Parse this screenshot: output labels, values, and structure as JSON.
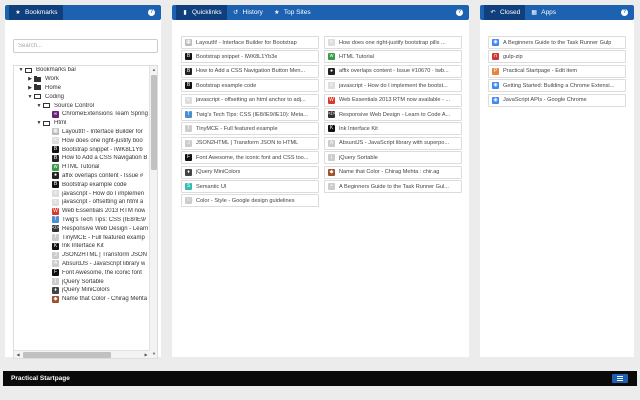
{
  "bookmarks_panel": {
    "tab_label": "Bookmarks",
    "search_placeholder": "Search...",
    "tree": [
      {
        "label": "Bookmarks bar",
        "level": 0,
        "type": "folder-open",
        "twisty": "▼"
      },
      {
        "label": "Work",
        "level": 1,
        "type": "folder",
        "twisty": "▶"
      },
      {
        "label": "Home",
        "level": 1,
        "type": "folder",
        "twisty": "▶"
      },
      {
        "label": "Coding",
        "level": 1,
        "type": "folder-open",
        "twisty": "▼"
      },
      {
        "label": "Source Control",
        "level": 2,
        "type": "folder-open",
        "twisty": "▼"
      },
      {
        "label": "ChromeExtensions Team Spring",
        "level": 3,
        "type": "link",
        "icon": "tfs",
        "color": "#68217a"
      },
      {
        "label": "Html",
        "level": 2,
        "type": "folder-open",
        "twisty": "▼"
      },
      {
        "label": "LayoutIt! - Interface Builder for",
        "level": 3,
        "type": "link",
        "icon": "grid",
        "color": "#bbb"
      },
      {
        "label": "How does one right-justify boo",
        "level": 3,
        "type": "link",
        "icon": "so",
        "color": "#ddd"
      },
      {
        "label": "Bootstrap snippet - IWK8L1Yb",
        "level": 3,
        "type": "link",
        "icon": "bs",
        "color": "#111"
      },
      {
        "label": "How to Add a CSS Navigation B",
        "level": 3,
        "type": "link",
        "icon": "bs",
        "color": "#222"
      },
      {
        "label": "HTML Tutorial",
        "level": 3,
        "type": "link",
        "icon": "w3",
        "color": "#3a9c49"
      },
      {
        "label": "affix overlaps content - Issue #",
        "level": 3,
        "type": "link",
        "icon": "gh",
        "color": "#222"
      },
      {
        "label": "Bootstrap example code",
        "level": 3,
        "type": "link",
        "icon": "bs",
        "color": "#111"
      },
      {
        "label": "javascript - How do I implemen",
        "level": 3,
        "type": "link",
        "icon": "so",
        "color": "#ddd"
      },
      {
        "label": "javascript - offsetting an html a",
        "level": 3,
        "type": "link",
        "icon": "so",
        "color": "#ddd"
      },
      {
        "label": "Web Essentials 2013 RTM now",
        "level": 3,
        "type": "link",
        "icon": "we",
        "color": "#d9392b"
      },
      {
        "label": "Twig's Tech Tips: CSS (IE8/IE9/",
        "level": 3,
        "type": "link",
        "icon": "tt",
        "color": "#4a8fd6"
      },
      {
        "label": "Responsive Web Design - Learn",
        "level": 3,
        "type": "link",
        "icon": "rw",
        "color": "#333"
      },
      {
        "label": "TinyMCE - Full featured examp",
        "level": 3,
        "type": "link",
        "icon": "tm",
        "color": "#ccc"
      },
      {
        "label": "Ink Interface Kit",
        "level": 3,
        "type": "link",
        "icon": "ik",
        "color": "#111"
      },
      {
        "label": "JSON2HTML | Transform JSON",
        "level": 3,
        "type": "link",
        "icon": "jh",
        "color": "#ccc"
      },
      {
        "label": "AbsurdJS - JavaScript library w",
        "level": 3,
        "type": "link",
        "icon": "ab",
        "color": "#ccc"
      },
      {
        "label": "Font Awesome, the iconic font",
        "level": 3,
        "type": "link",
        "icon": "fa",
        "color": "#111"
      },
      {
        "label": "jQuery Sortable",
        "level": 3,
        "type": "link",
        "icon": "jq",
        "color": "#ccc"
      },
      {
        "label": "jQuery MiniColors",
        "level": 3,
        "type": "link",
        "icon": "jm",
        "color": "#444"
      },
      {
        "label": "Name that Color - Chirag Mehta",
        "level": 3,
        "type": "link",
        "icon": "nc",
        "color": "#a0522d"
      }
    ]
  },
  "quicklinks_panel": {
    "tabs": [
      {
        "label": "Quicklinks",
        "icon": "bookmark-icon",
        "active": true
      },
      {
        "label": "History",
        "icon": "history-icon",
        "active": false
      },
      {
        "label": "Top Sites",
        "icon": "star-icon",
        "active": false
      }
    ],
    "links": [
      {
        "label": "LayoutIt! - Interface Builder for Bootstrap",
        "icon": "grid",
        "color": "#bbb"
      },
      {
        "label": "How does one right-justify bootstrap pills ...",
        "icon": "so",
        "color": "#ddd"
      },
      {
        "label": "Bootstrap snippet - IWK8L1Yb3e",
        "icon": "bs",
        "color": "#111"
      },
      {
        "label": "HTML Tutorial",
        "icon": "w3",
        "color": "#3a9c49"
      },
      {
        "label": "How to Add a CSS Navigation Button Men...",
        "icon": "bs",
        "color": "#222"
      },
      {
        "label": "affix overlaps content - Issue #10670 · twb...",
        "icon": "gh",
        "color": "#222"
      },
      {
        "label": "Bootstrap example code",
        "icon": "bs",
        "color": "#111"
      },
      {
        "label": "javascript - How do I implement the bootst...",
        "icon": "so",
        "color": "#ddd"
      },
      {
        "label": "javascript - offsetting an html anchor to adj...",
        "icon": "so",
        "color": "#ddd"
      },
      {
        "label": "Web Essentials 2013 RTM now available - ...",
        "icon": "we",
        "color": "#d9392b"
      },
      {
        "label": "Twig's Tech Tips: CSS (IE8/IE9/IE10): Meta...",
        "icon": "tt",
        "color": "#4a8fd6"
      },
      {
        "label": "Responsive Web Design - Learn to Code A...",
        "icon": "rw",
        "color": "#333"
      },
      {
        "label": "TinyMCE - Full featured example",
        "icon": "tm",
        "color": "#ccc"
      },
      {
        "label": "Ink Interface Kit",
        "icon": "ik",
        "color": "#111"
      },
      {
        "label": "JSON2HTML | Transform JSON to HTML",
        "icon": "jh",
        "color": "#ccc"
      },
      {
        "label": "AbsurdJS - JavaScript library with superpo...",
        "icon": "ab",
        "color": "#ccc"
      },
      {
        "label": "Font Awesome, the iconic font and CSS too...",
        "icon": "fa",
        "color": "#111"
      },
      {
        "label": "jQuery Sortable",
        "icon": "jq",
        "color": "#ccc"
      },
      {
        "label": "jQuery MiniColors",
        "icon": "jm",
        "color": "#444"
      },
      {
        "label": "Name that Color - Chirag Mehta : chir.ag",
        "icon": "nc",
        "color": "#a0522d"
      },
      {
        "label": "Semantic UI",
        "icon": "su",
        "color": "#35bdb2"
      },
      {
        "label": "A Beginners Guide to the Task Runner Gul...",
        "icon": "gp",
        "color": "#ccc"
      },
      {
        "label": "Color - Style - Google design guidelines",
        "icon": "gd",
        "color": "#ccc"
      }
    ]
  },
  "recent_panel": {
    "tabs": [
      {
        "label": "Closed",
        "icon": "undo-icon",
        "active": true
      },
      {
        "label": "Apps",
        "icon": "apps-icon",
        "active": false
      }
    ],
    "links": [
      {
        "label": "A Beginners Guide to the Task Runner Gulp",
        "icon": "chrome",
        "color": "#4285f4"
      },
      {
        "label": "gulp-zip",
        "icon": "npm",
        "color": "#cb3837"
      },
      {
        "label": "Practical Startpage - Edit item",
        "icon": "ps",
        "color": "#e8833a"
      },
      {
        "label": "Getting Started: Building a Chrome Extensi...",
        "icon": "chrome",
        "color": "#4285f4"
      },
      {
        "label": "JavaScript APIs - Google Chrome",
        "icon": "chrome",
        "color": "#4285f4"
      }
    ]
  },
  "footer": {
    "title": "Practical Startpage"
  },
  "colors": {
    "accent": "#1d61b1",
    "accent_dark": "#0f3f7c",
    "footer_bg": "#0a0a0a"
  }
}
